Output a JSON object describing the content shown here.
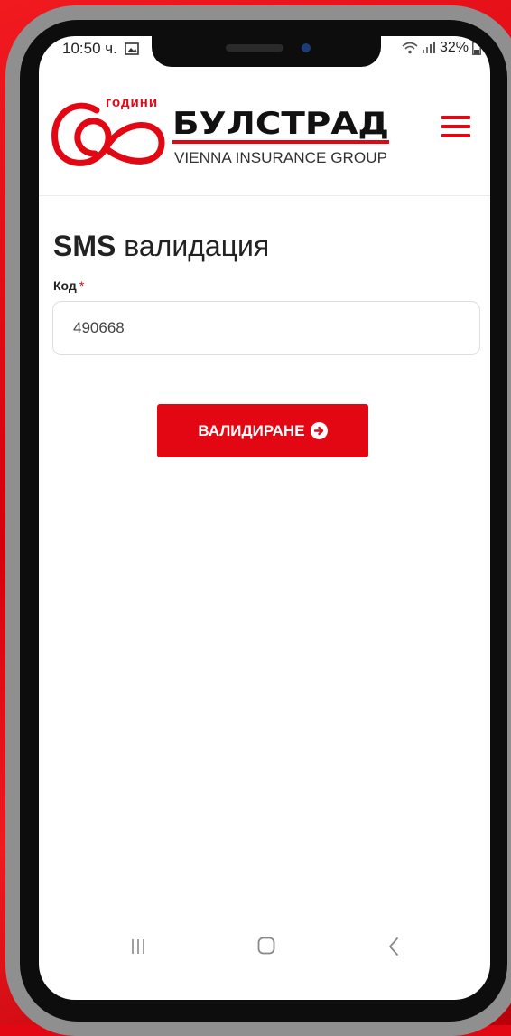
{
  "status_bar": {
    "time": "10:50 ч.",
    "battery": "32%"
  },
  "header": {
    "logo": {
      "years_number": "60",
      "years_word": "години",
      "brand": "БУЛСТРАД",
      "subtitle": "VIENNA INSURANCE GROUP"
    },
    "menu_icon": "hamburger-icon"
  },
  "form": {
    "title_bold": "SMS",
    "title_rest": " валидация",
    "code_label": "Код",
    "required_mark": "*",
    "code_value": "490668",
    "submit_label": "ВАЛИДИРАНЕ"
  },
  "nav_bar": {
    "icons": [
      "recents-icon",
      "home-icon",
      "back-icon"
    ]
  },
  "colors": {
    "brand_red": "#e30613",
    "text_dark": "#222222",
    "input_border": "#dedede"
  }
}
